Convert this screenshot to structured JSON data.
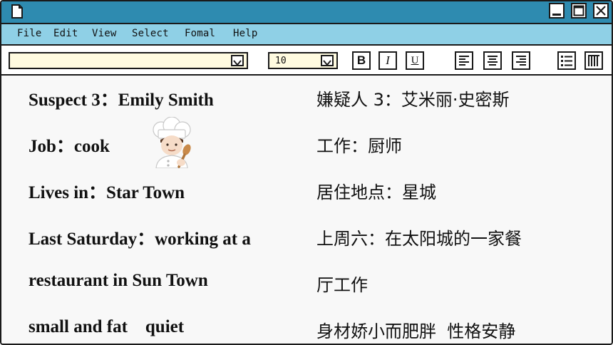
{
  "menu": [
    "File",
    "Edit",
    "View",
    "Select",
    "Fomal",
    "Help"
  ],
  "toolbar": {
    "font_name": "",
    "font_size": "10",
    "bold_label": "B",
    "italic_label": "I",
    "underline_label": "U"
  },
  "content": {
    "english": [
      "Suspect 3：Emily Smith",
      "Job：cook",
      "Lives in：Star Town",
      "Last Saturday：working at a",
      "restaurant in Sun Town",
      "small and fat    quiet"
    ],
    "chinese": [
      "嫌疑人 3：艾米丽·史密斯",
      "工作：厨师",
      "居住地点：星城",
      "上周六：在太阳城的一家餐",
      "厅工作",
      "身材娇小而肥胖  性格安静"
    ]
  },
  "icons": {
    "app": "document-icon",
    "minimize": "minimize-icon",
    "maximize": "maximize-icon",
    "close": "close-icon",
    "chef": "chef-emoji-icon"
  },
  "colors": {
    "titlebar": "#2e8bb0",
    "menubar": "#8fd0e6",
    "field": "#fffbe0"
  }
}
